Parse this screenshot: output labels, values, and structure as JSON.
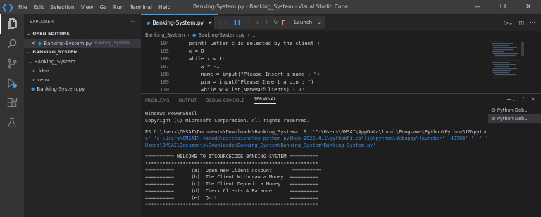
{
  "window": {
    "title": "Banking-System.py - Banking_System - Visual Studio Code",
    "menu": [
      "File",
      "Edit",
      "Selection",
      "View",
      "Go",
      "Run",
      "Terminal",
      "Help"
    ]
  },
  "sidebar": {
    "header": "EXPLORER",
    "more": "···",
    "open_editors_label": "OPEN EDITORS",
    "open_editor": {
      "name": "Banking-System.py",
      "folder": "Banking_System"
    },
    "workspace_label": "BANKING_SYSTEM",
    "tree": [
      {
        "label": "Banking_System",
        "kind": "folder-open"
      },
      {
        "label": ".idea",
        "kind": "folder"
      },
      {
        "label": "venv",
        "kind": "folder"
      },
      {
        "label": "Banking-System.py",
        "kind": "python-file"
      }
    ]
  },
  "editor": {
    "tab": "Banking-System.py",
    "run_config": "Launch",
    "breadcrumb": [
      "Banking_System",
      "Banking-System.py",
      "..."
    ],
    "lines": [
      {
        "n": "104",
        "text": "print( Letter c is selected by the client )"
      },
      {
        "n": "105",
        "text": "x = 0"
      },
      {
        "n": "106",
        "text": "while x < 1:"
      },
      {
        "n": "107",
        "text": "    w = -1"
      },
      {
        "n": "108",
        "text": "    name = input(\"Please Insert a name : \")"
      },
      {
        "n": "109",
        "text": "    pin = input(\"Please Insert a pin : \")"
      },
      {
        "n": "110",
        "text": "    while w < len(NamesOfClients) - 1:"
      }
    ]
  },
  "panel": {
    "tabs": [
      "PROBLEMS",
      "OUTPUT",
      "DEBUG CONSOLE",
      "TERMINAL"
    ],
    "active_tab": "TERMINAL",
    "terminals": [
      "Python Deb...",
      "Python Deb..."
    ],
    "terminal_lines": [
      "Windows PowerShell",
      "Copyright (C) Microsoft Corporation. All rights reserved.",
      "",
      "PS C:\\Users\\OMSAI\\Documents\\Downloads\\Banking_System>  &  'C:\\Users\\OMSAI\\AppData\\Local\\Programs\\Python\\Python310\\python.ex",
      "e' 'c:\\Users\\OMSAI\\.vscode\\extensions\\ms-python.python-2022.4.1\\pythonFiles\\lib\\python\\debugpy\\launcher' '49788' '--' 'c:\\",
      "Users\\OMSAI\\Documents\\Downloads\\Banking_System\\Banking_System\\Banking-System.py'",
      "",
      "========== WELCOME TO ITSOURCECODE BANKING SYSTEM ==========",
      "************************************************************",
      "==========      (a). Open New Client Account       ==========",
      "==========      (b). The Client Withdraw a Money  ==========",
      "==========      (c). The Client Deposit a Money   ==========",
      "==========      (d). Check Clients & Balance      ==========",
      "==========      (e). Quit                         ==========",
      "************************************************************"
    ]
  },
  "colors": {
    "accent": "#3aa0f3",
    "titlebar": "#3c3c3c",
    "sidebar": "#252526",
    "editor_bg": "#1e1e1e"
  }
}
